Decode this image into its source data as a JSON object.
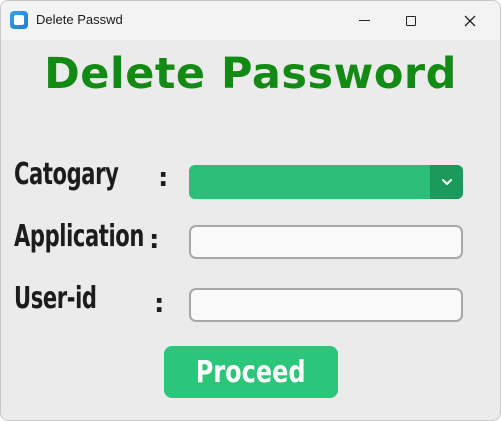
{
  "window": {
    "title": "Delete Passwd",
    "icon": "app-icon",
    "controls": [
      "minimize-icon",
      "maximize-icon",
      "close-icon"
    ]
  },
  "heading": "Delete Password",
  "form": {
    "category": {
      "label": "Catogary",
      "colon": ":",
      "value": ""
    },
    "application": {
      "label": "Application",
      "colon": ":",
      "value": "",
      "placeholder": ""
    },
    "user_id": {
      "label": "User-id",
      "colon": ":",
      "value": "",
      "placeholder": ""
    }
  },
  "proceed_label": "Proceed",
  "colors": {
    "heading": "#138a13",
    "accent": "#2bbf79",
    "accent_dark": "#1c9a5c",
    "button": "#2bc67a",
    "background": "#ebebeb"
  }
}
